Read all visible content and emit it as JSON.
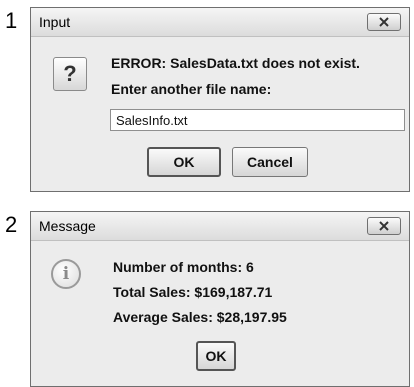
{
  "step_numbers": [
    "1",
    "2"
  ],
  "input_dialog": {
    "title": "Input",
    "icon": "question-icon",
    "icon_glyph": "?",
    "message_line1": "ERROR: SalesData.txt does not exist.",
    "message_line2": "Enter another file name:",
    "input_value": "SalesInfo.txt",
    "ok_label": "OK",
    "cancel_label": "Cancel"
  },
  "message_dialog": {
    "title": "Message",
    "icon": "info-icon",
    "icon_glyph": "i",
    "line1": "Number of months: 6",
    "line2": "Total Sales: $169,187.71",
    "line3": "Average Sales: $28,197.95",
    "ok_label": "OK"
  }
}
